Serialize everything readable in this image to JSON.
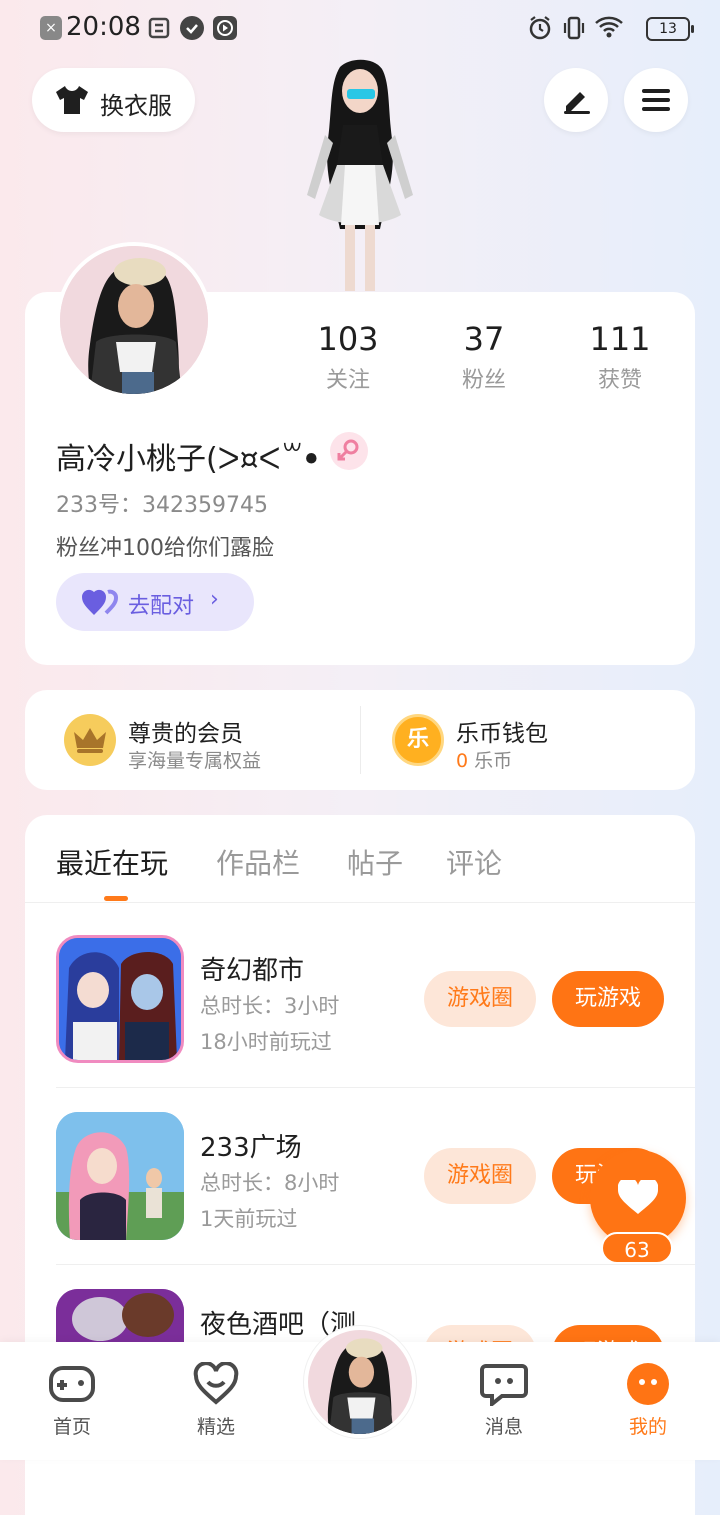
{
  "status_bar": {
    "time": "20:08",
    "battery": "13"
  },
  "header": {
    "outfit_label": "换衣服"
  },
  "profile": {
    "stats": [
      {
        "value": "103",
        "label": "关注"
      },
      {
        "value": "37",
        "label": "粉丝"
      },
      {
        "value": "111",
        "label": "获赞"
      }
    ],
    "nickname": "高冷小桃子(ᐳ¤ᐸ꒳ꔷ",
    "uid": "233号：342359745",
    "bio": "粉丝冲100给你们露脸",
    "match_label": "去配对"
  },
  "perks": {
    "vip_title": "尊贵的会员",
    "vip_sub": "享海量专属权益",
    "wallet_title": "乐币钱包",
    "wallet_amount": "0",
    "wallet_unit": "乐币",
    "coin_glyph": "乐"
  },
  "tabs": [
    "最近在玩",
    "作品栏",
    "帖子",
    "评论"
  ],
  "games": [
    {
      "name": "奇幻都市",
      "duration": "总时长：3小时",
      "last_played": "18小时前玩过",
      "circle_label": "游戏圈",
      "play_label": "玩游戏"
    },
    {
      "name": "233广场",
      "duration": "总时长：8小时",
      "last_played": "1天前玩过",
      "circle_label": "游戏圈",
      "play_label": "玩游戏"
    },
    {
      "name": "夜色酒吧（测",
      "duration": "",
      "last_played": "",
      "circle_label": "游戏圈",
      "play_label": "玩游戏"
    }
  ],
  "floating_like": {
    "count": "63"
  },
  "bottom_nav": [
    {
      "label": "首页"
    },
    {
      "label": "精选"
    },
    {
      "label": "消息"
    },
    {
      "label": "我的"
    }
  ],
  "colors": {
    "accent": "#ff7414",
    "match": "#6a5ee0",
    "pink": "#ef7fa0"
  }
}
